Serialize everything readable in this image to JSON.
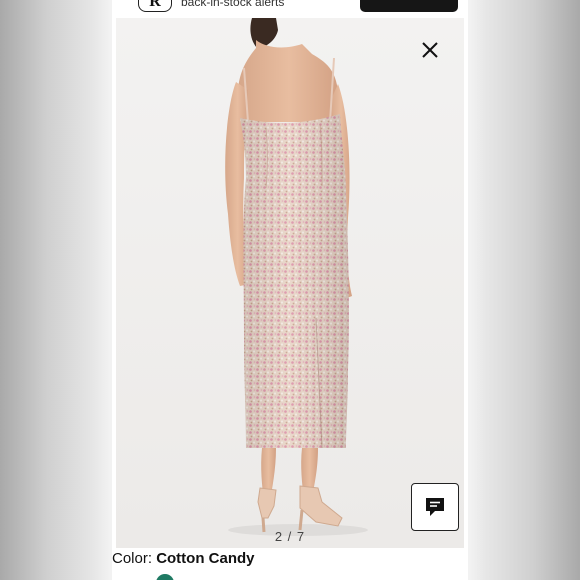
{
  "banner": {
    "alert_text": "back-in-stock alerts",
    "logo_letter": "R",
    "cta_label": ""
  },
  "gallery": {
    "counter": "2 / 7",
    "current": 2,
    "total": 7
  },
  "product": {
    "color_label": "Color:",
    "color_value": "Cotton Candy"
  },
  "icons": {
    "close": "close-icon",
    "chat": "chat-icon"
  },
  "colors": {
    "cta_background": "#161616",
    "swatch_selected": "#1f7a63",
    "dress_pink": "#e3a3b4",
    "dress_champagne": "#e8d2c1"
  }
}
